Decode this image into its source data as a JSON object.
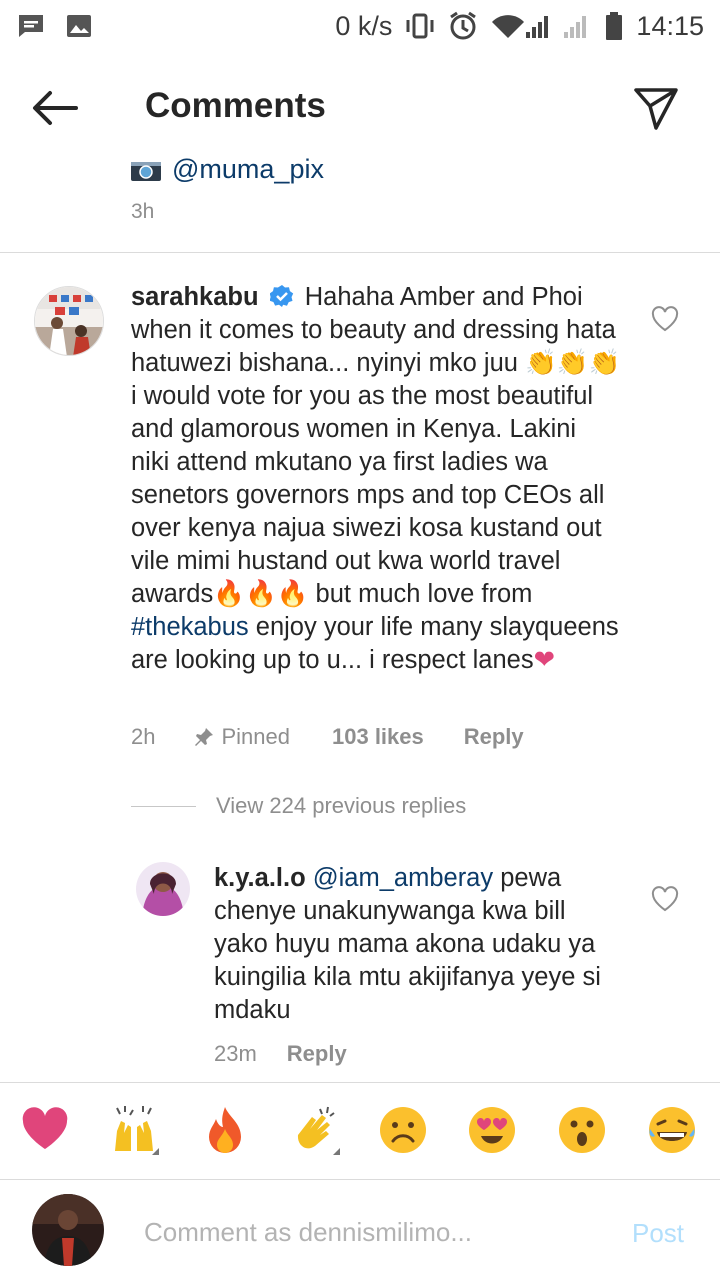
{
  "status_bar": {
    "net_speed": "0 k/s",
    "time": "14:15",
    "icons": [
      "message-icon",
      "image-icon",
      "vibrate-icon",
      "alarm-icon",
      "wifi-icon",
      "signal-icon",
      "signal-icon",
      "battery-icon"
    ]
  },
  "header": {
    "title": "Comments"
  },
  "caption_tail": {
    "mention": "@muma_pix",
    "time": "3h"
  },
  "comment": {
    "username": "sarahkabu",
    "text_a": "Hahaha Amber and Phoi when it comes to beauty and dressing hata hatuwezi bishana... nyinyi mko juu ",
    "clap_emojis": "👏👏👏",
    "text_b": " i would vote for you as the most beautiful and glamorous women in Kenya. Lakini niki attend mkutano ya first ladies wa senetors  governors mps and top CEOs all over kenya najua siwezi kosa kustand  out vile mimi hustand out kwa world travel awards",
    "fire_emojis": "🔥🔥🔥",
    "text_c": " but much love from ",
    "hashtag": "#thekabus",
    "text_d": " enjoy your life many slayqueens are looking up to u... i respect lanes",
    "heart_emoji": "❤",
    "time": "2h",
    "pinned_label": "Pinned",
    "likes": "103 likes",
    "reply_label": "Reply"
  },
  "view_replies": "View 224 previous replies",
  "reply": {
    "username": "k.y.a.l.o",
    "mention": "@iam_amberay",
    "text": " pewa chenye unakunywanga kwa bill yako huyu mama akona udaku ya kuingilia kila mtu akijifanya yeye si mdaku",
    "time": "23m",
    "reply_label": "Reply"
  },
  "emoji_bar": [
    "heart",
    "raised-hands",
    "fire",
    "clapping-hands",
    "frowning-face",
    "heart-eyes",
    "surprised",
    "laughing-tears"
  ],
  "input": {
    "placeholder": "Comment as dennismilimo...",
    "post_label": "Post"
  }
}
